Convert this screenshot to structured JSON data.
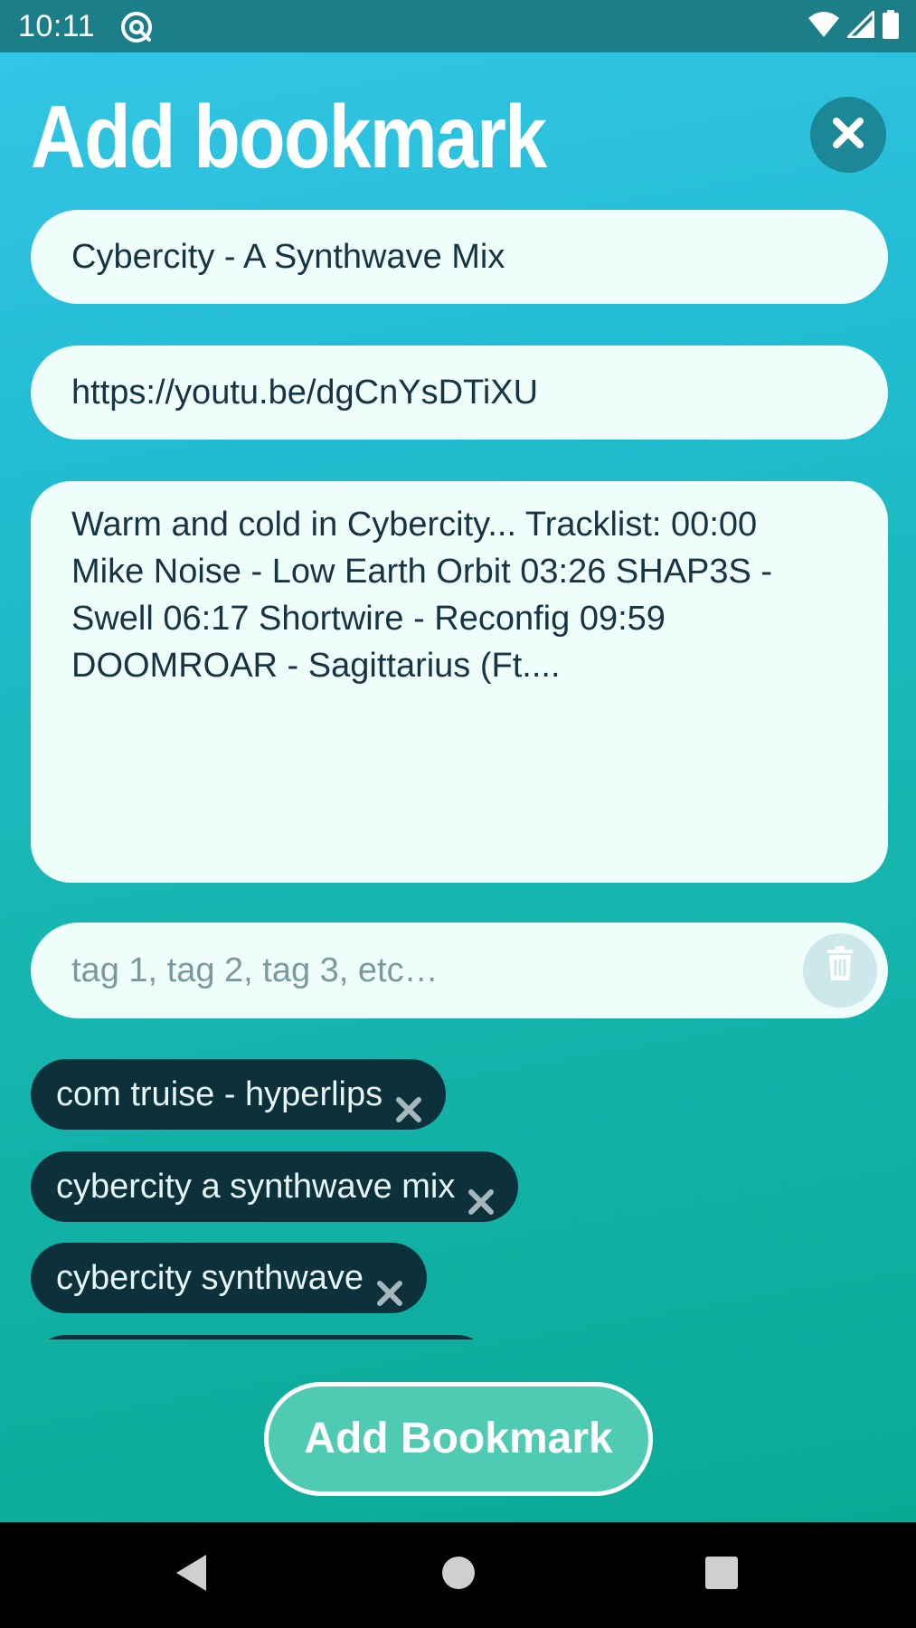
{
  "status_bar": {
    "time": "10:11",
    "icons": [
      "at-sign-icon",
      "wifi-icon",
      "cellular-signal-icon",
      "battery-icon"
    ]
  },
  "page": {
    "title": "Add bookmark"
  },
  "form": {
    "title_value": "Cybercity - A Synthwave Mix",
    "url_value": "https://youtu.be/dgCnYsDTiXU",
    "description_value": "Warm and cold in Cybercity... Tracklist: 00:00 Mike Noise - Low Earth Orbit 03:26 SHAP3S - Swell 06:17 Shortwire - Reconfig 09:59 DOOMROAR - Sagittarius (Ft....",
    "tags_placeholder": "tag 1, tag 2, tag 3, etc…",
    "tags_value": ""
  },
  "tags": [
    {
      "label": "com truise - hyperlips"
    },
    {
      "label": "cybercity a synthwave mix"
    },
    {
      "label": "cybercity synthwave"
    }
  ],
  "actions": {
    "add_label": "Add Bookmark"
  },
  "colors": {
    "status_bar": "#1b7e88",
    "gradient_top": "#33c5e6",
    "gradient_bottom": "#0aa996",
    "field_bg": "#effdfb",
    "chip_bg": "#0d313b",
    "button_bg": "#4fcbb4"
  }
}
